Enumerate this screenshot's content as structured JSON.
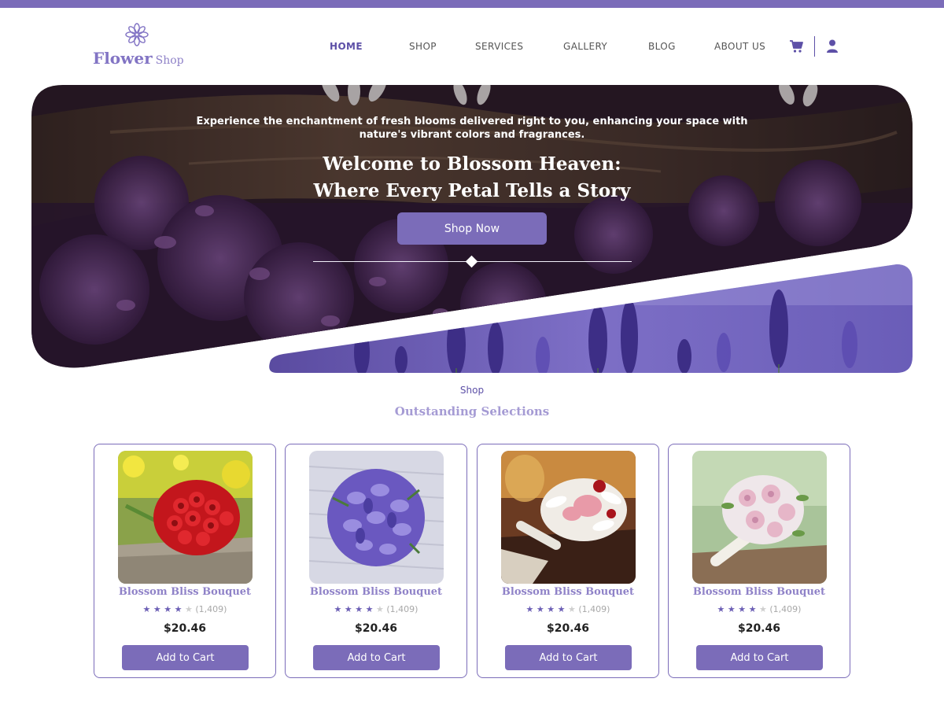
{
  "brand": {
    "name_main": "Flower",
    "name_sub": "Shop",
    "logo_icon": "mandala-flower-icon"
  },
  "colors": {
    "accent": "#7b6cb9",
    "accent_dark": "#5d50a7",
    "accent_light": "#a59bd4"
  },
  "nav": {
    "items": [
      {
        "label": "HOME",
        "active": true
      },
      {
        "label": "SHOP",
        "active": false
      },
      {
        "label": "SERVICES",
        "active": false
      },
      {
        "label": "GALLERY",
        "active": false
      },
      {
        "label": "BLOG",
        "active": false
      },
      {
        "label": "ABOUT US",
        "active": false
      }
    ],
    "cart_icon": "cart-icon",
    "user_icon": "user-icon"
  },
  "hero": {
    "subtitle": "Experience the enchantment of fresh blooms delivered right to you, enhancing your space with nature's vibrant colors and fragrances.",
    "title_line1": "Welcome to Blossom Heaven:",
    "title_line2": "Where Every Petal Tells a Story",
    "cta_label": "Shop Now"
  },
  "section": {
    "tag": "Shop",
    "title": "Outstanding Selections"
  },
  "products": [
    {
      "name": "Blossom Bliss Bouquet",
      "rating": 4,
      "reviews": "(1,409)",
      "price": "$20.46",
      "cta": "Add to Cart",
      "image": "red-roses-bouquet"
    },
    {
      "name": "Blossom Bliss Bouquet",
      "rating": 4,
      "reviews": "(1,409)",
      "price": "$20.46",
      "cta": "Add to Cart",
      "image": "purple-flowers-bouquet"
    },
    {
      "name": "Blossom Bliss Bouquet",
      "rating": 4,
      "reviews": "(1,409)",
      "price": "$20.46",
      "cta": "Add to Cart",
      "image": "white-pink-lilies-bouquet"
    },
    {
      "name": "Blossom Bliss Bouquet",
      "rating": 4,
      "reviews": "(1,409)",
      "price": "$20.46",
      "cta": "Add to Cart",
      "image": "pastel-roses-bouquet"
    }
  ]
}
